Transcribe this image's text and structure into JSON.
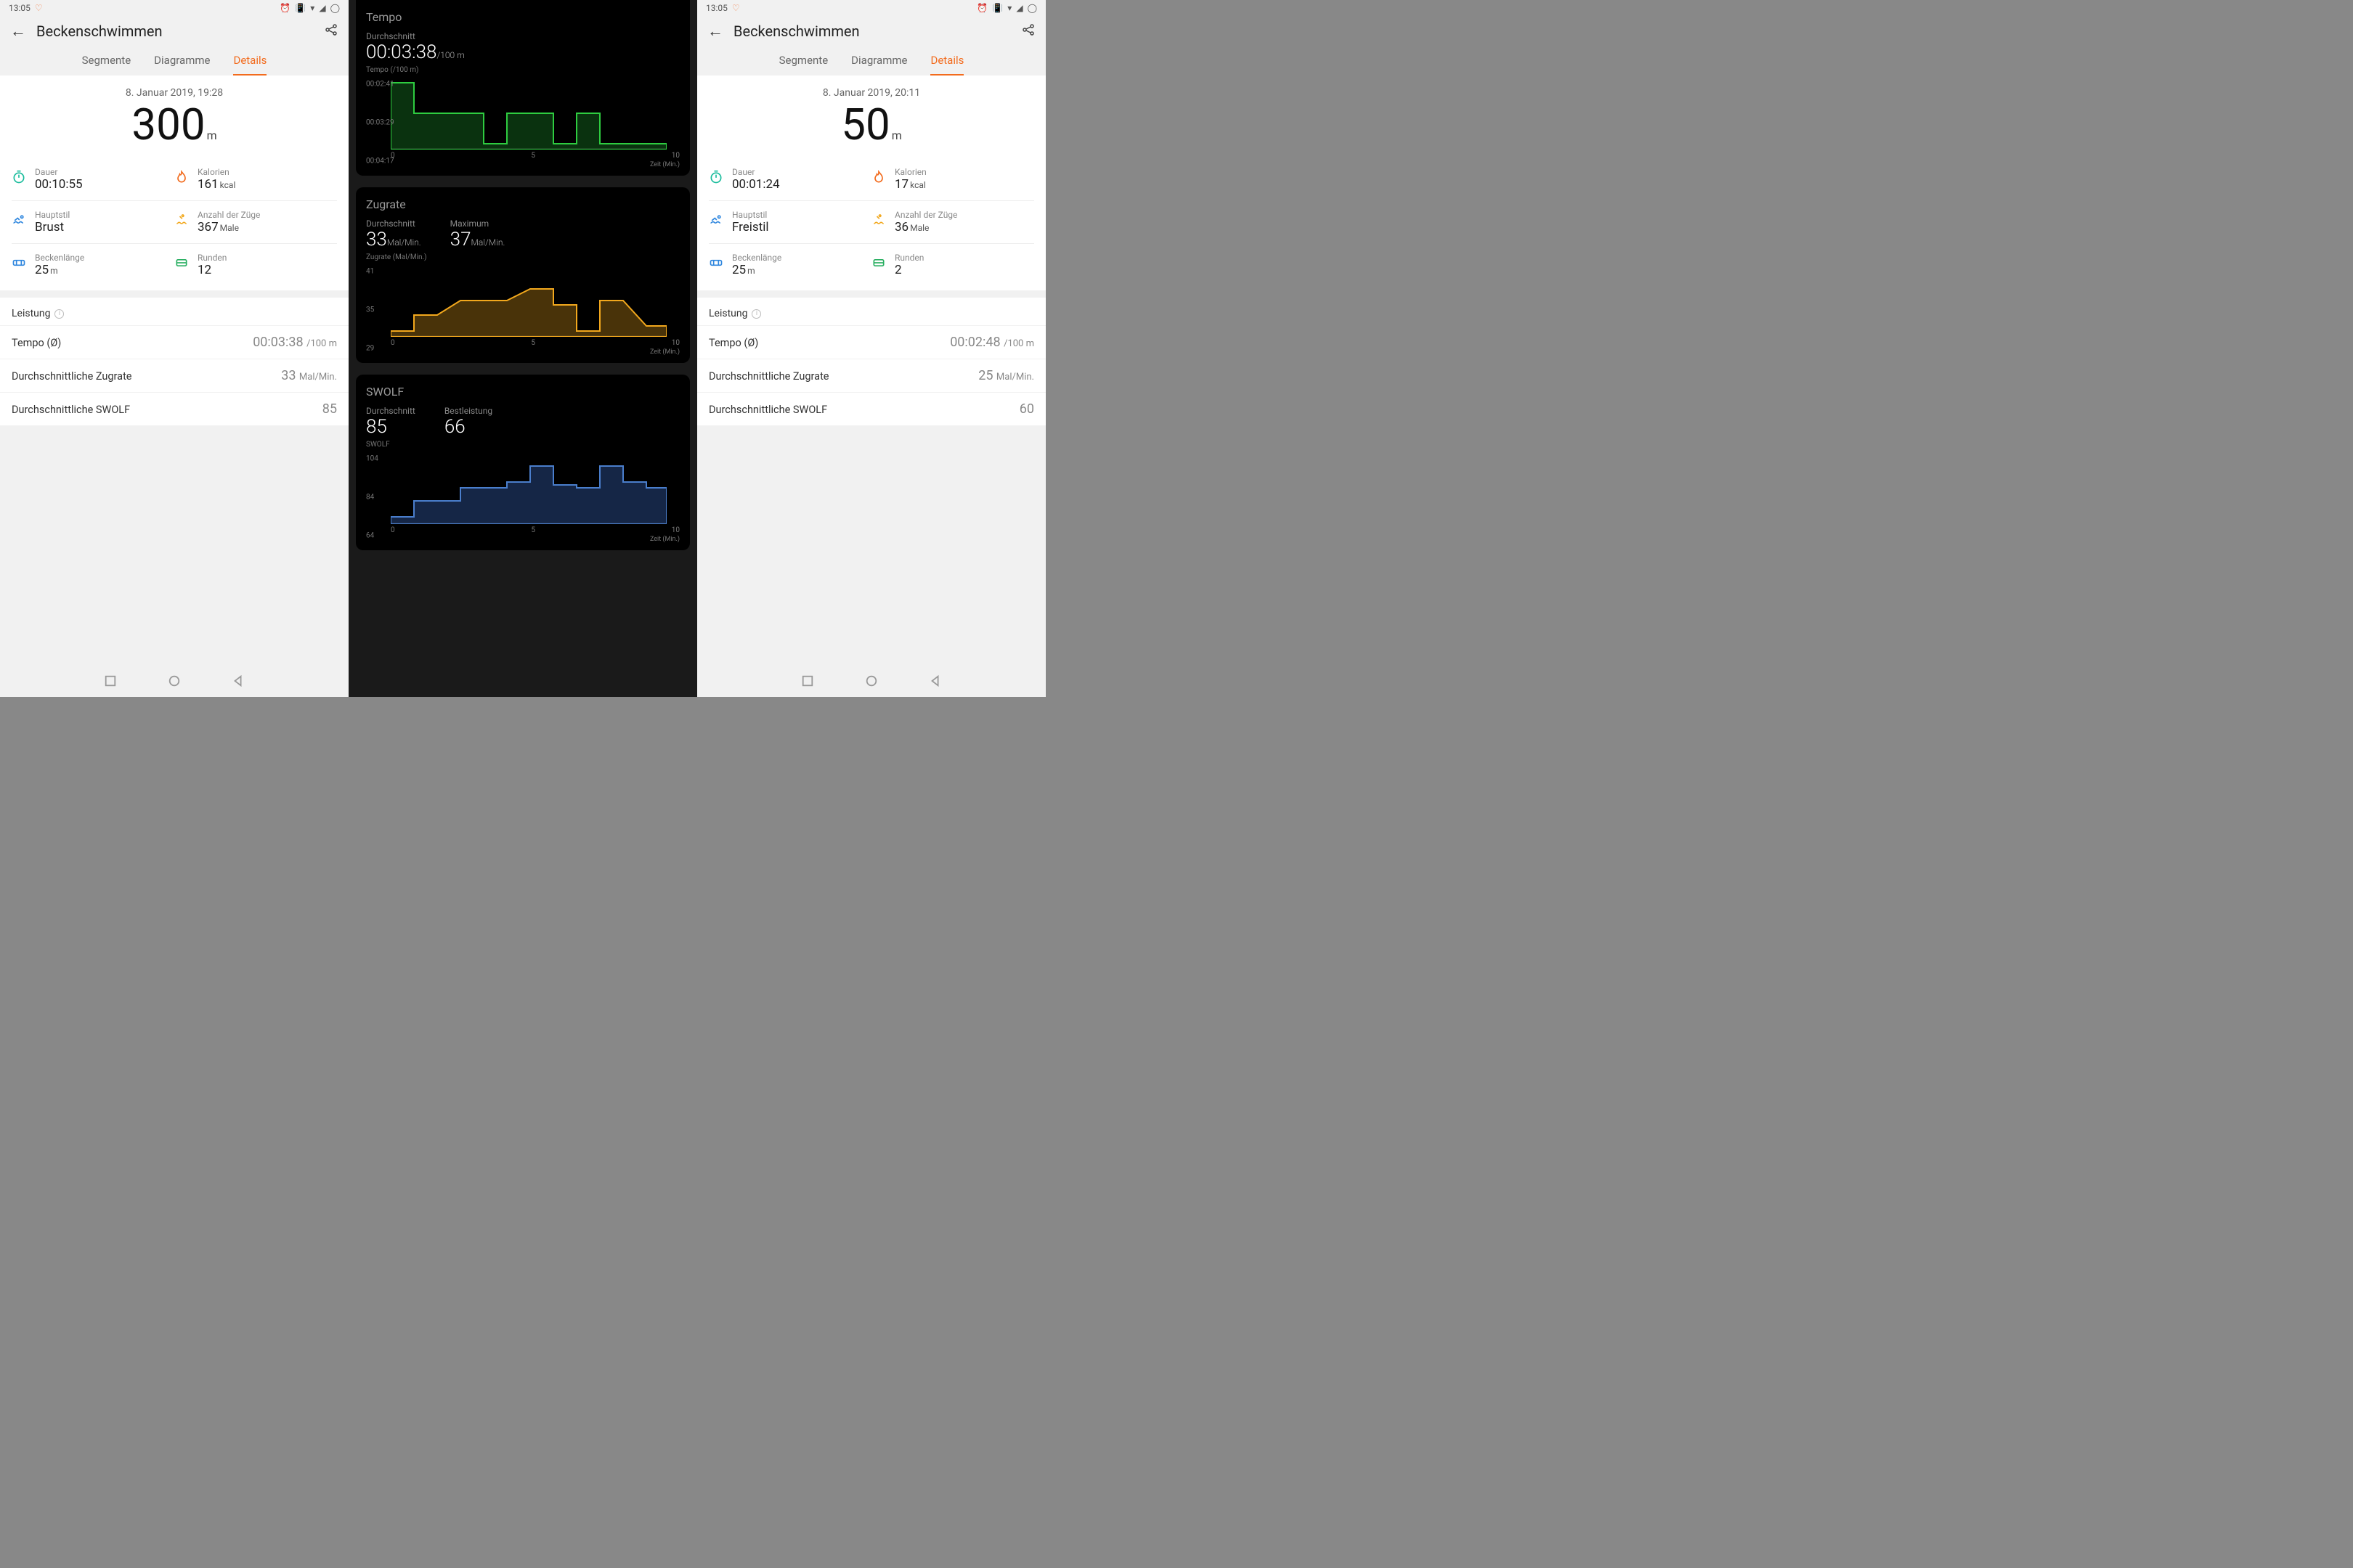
{
  "status": {
    "time": "13:05"
  },
  "header": {
    "title": "Beckenschwimmen"
  },
  "tabs": {
    "t1": "Segmente",
    "t2": "Diagramme",
    "t3": "Details"
  },
  "left": {
    "date": "8. Januar 2019, 19:28",
    "distance_val": "300",
    "distance_unit": "m",
    "stats": {
      "dauer_l": "Dauer",
      "dauer_v": "00:10:55",
      "kal_l": "Kalorien",
      "kal_v": "161",
      "kal_u": "kcal",
      "stil_l": "Hauptstil",
      "stil_v": "Brust",
      "zuege_l": "Anzahl der Züge",
      "zuege_v": "367",
      "zuege_u": "Male",
      "len_l": "Beckenlänge",
      "len_v": "25",
      "len_u": "m",
      "run_l": "Runden",
      "run_v": "12"
    },
    "perf": {
      "header": "Leistung",
      "tempo_l": "Tempo (Ø)",
      "tempo_v": "00:03:38",
      "tempo_u": "/100 m",
      "zug_l": "Durchschnittliche Zugrate",
      "zug_v": "33",
      "zug_u": "Mal/Min.",
      "swolf_l": "Durchschnittliche SWOLF",
      "swolf_v": "85"
    }
  },
  "right": {
    "date": "8. Januar 2019, 20:11",
    "distance_val": "50",
    "distance_unit": "m",
    "stats": {
      "dauer_l": "Dauer",
      "dauer_v": "00:01:24",
      "kal_l": "Kalorien",
      "kal_v": "17",
      "kal_u": "kcal",
      "stil_l": "Hauptstil",
      "stil_v": "Freistil",
      "zuege_l": "Anzahl der Züge",
      "zuege_v": "36",
      "zuege_u": "Male",
      "len_l": "Beckenlänge",
      "len_v": "25",
      "len_u": "m",
      "run_l": "Runden",
      "run_v": "2"
    },
    "perf": {
      "header": "Leistung",
      "tempo_l": "Tempo (Ø)",
      "tempo_v": "00:02:48",
      "tempo_u": "/100 m",
      "zug_l": "Durchschnittliche Zugrate",
      "zug_v": "25",
      "zug_u": "Mal/Min.",
      "swolf_l": "Durchschnittliche SWOLF",
      "swolf_v": "60"
    }
  },
  "mid": {
    "tempo": {
      "title": "Tempo",
      "avg_l": "Durchschnitt",
      "avg_v": "00:03:38",
      "avg_u": "/100 m",
      "sub": "Tempo (/100 m)"
    },
    "zugrate": {
      "title": "Zugrate",
      "avg_l": "Durchschnitt",
      "avg_v": "33",
      "avg_u": "Mal/Min.",
      "max_l": "Maximum",
      "max_v": "37",
      "max_u": "Mal/Min.",
      "sub": "Zugrate (Mal/Min.)"
    },
    "swolf": {
      "title": "SWOLF",
      "avg_l": "Durchschnitt",
      "avg_v": "85",
      "best_l": "Bestleistung",
      "best_v": "66",
      "sub": "SWOLF"
    },
    "x0": "0",
    "x5": "5",
    "x10": "10",
    "zeit": "Zeit (Min.)"
  },
  "chart_data": [
    {
      "type": "line",
      "title": "Tempo",
      "xlabel": "Zeit (Min.)",
      "ylabel": "Tempo (/100 m)",
      "yticks": [
        "00:02:41",
        "00:03:29",
        "00:04:17"
      ],
      "x": [
        0,
        1,
        2,
        3,
        4,
        5,
        6,
        7,
        8,
        9,
        10,
        11
      ],
      "values_sec": [
        161,
        209,
        209,
        209,
        257,
        209,
        209,
        257,
        209,
        257,
        257,
        257
      ],
      "note": "y inverted (faster=higher)"
    },
    {
      "type": "line",
      "title": "Zugrate",
      "xlabel": "Zeit (Min.)",
      "ylabel": "Zugrate (Mal/Min.)",
      "yticks": [
        29,
        35,
        41
      ],
      "x": [
        0,
        1,
        2,
        3,
        4,
        5,
        6,
        7,
        8,
        9,
        10,
        11
      ],
      "values": [
        29,
        32,
        32,
        35,
        35,
        35,
        37,
        34,
        29,
        35,
        35,
        30
      ]
    },
    {
      "type": "line",
      "title": "SWOLF",
      "xlabel": "Zeit (Min.)",
      "ylabel": "SWOLF",
      "yticks": [
        64,
        84,
        104
      ],
      "x": [
        0,
        1,
        2,
        3,
        4,
        5,
        6,
        7,
        8,
        9,
        10,
        11
      ],
      "values": [
        66,
        76,
        76,
        84,
        84,
        88,
        100,
        86,
        84,
        100,
        88,
        84
      ]
    }
  ],
  "yticks": {
    "tempo": {
      "a": "00:02:41",
      "b": "00:03:29",
      "c": "00:04:17"
    },
    "zug": {
      "a": "41",
      "b": "35",
      "c": "29"
    },
    "swolf": {
      "a": "104",
      "b": "84",
      "c": "64"
    }
  }
}
